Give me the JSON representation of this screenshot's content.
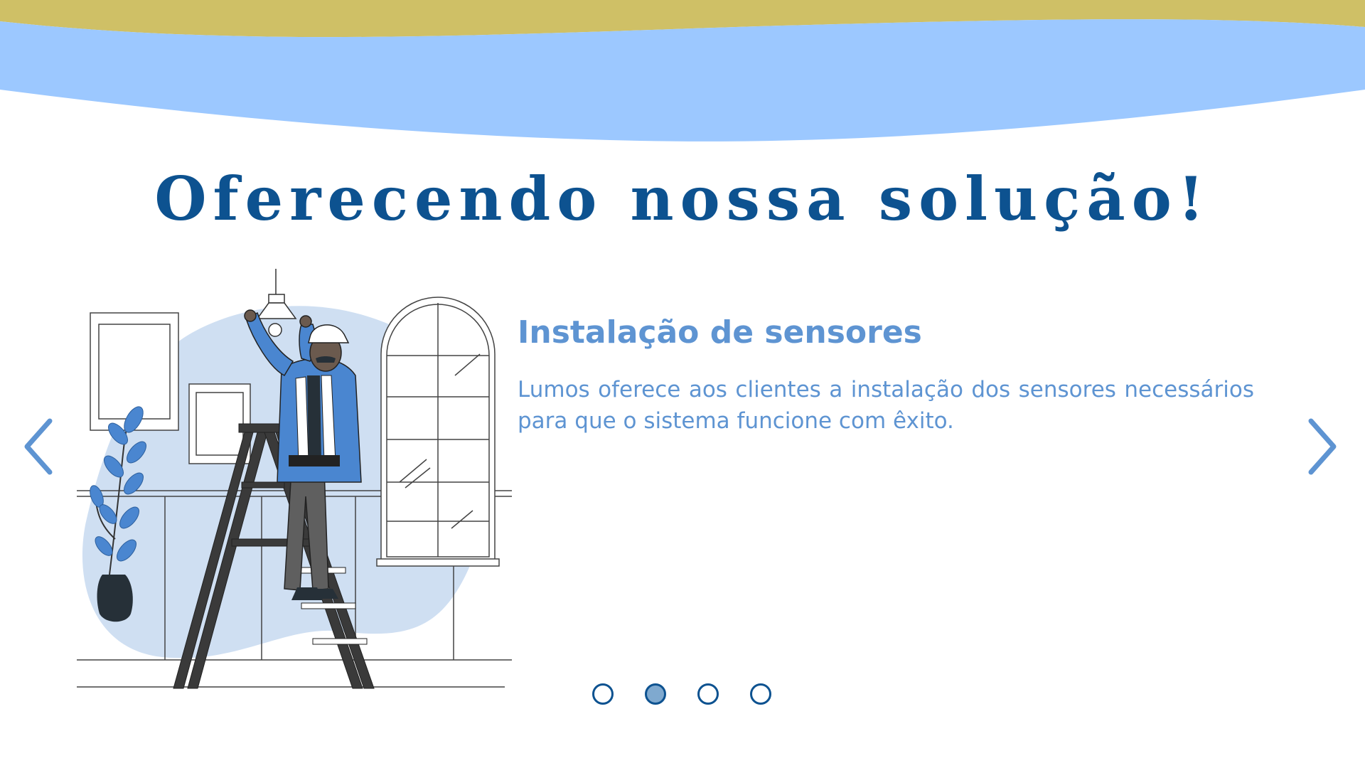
{
  "colors": {
    "wave_gold": "#cfc066",
    "wave_blue": "#9cc8ff",
    "title": "#0d5290",
    "accent": "#5e94d2",
    "blob": "#cfdff2",
    "dot_active": "#7fa9cf"
  },
  "header": {
    "title": "Oferecendo nossa solução!"
  },
  "slide": {
    "heading": "Instalação de sensores",
    "description": "Lumos oferece aos clientes a instalação dos sensores necessários para que o sistema funcione com êxito.",
    "illustration_icon": "electrician-on-ladder-illustration"
  },
  "carousel": {
    "prev_icon": "chevron-left-icon",
    "next_icon": "chevron-right-icon",
    "dots": [
      {
        "active": false
      },
      {
        "active": true
      },
      {
        "active": false
      },
      {
        "active": false
      }
    ]
  }
}
